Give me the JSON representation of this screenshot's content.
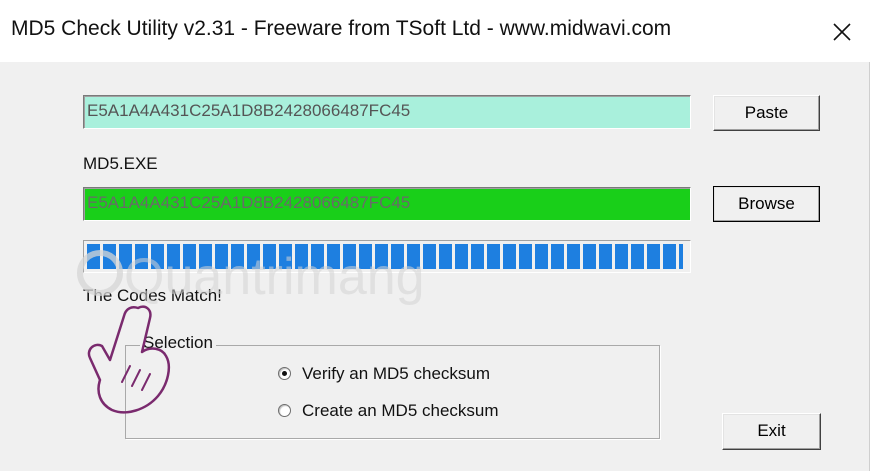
{
  "window": {
    "title": "MD5 Check Utility v2.31 - Freeware from TSoft Ltd - www.midwavi.com",
    "close_glyph": "✕"
  },
  "hash_input": {
    "value": "E5A1A4A431C25A1D8B2428066487FC45",
    "color": "#a9f0dc"
  },
  "paste_button": {
    "label": "Paste"
  },
  "file": {
    "name": "MD5.EXE",
    "hash": "E5A1A4A431C25A1D8B2428066487FC45",
    "color": "#19cf19"
  },
  "browse_button": {
    "label": "Browse"
  },
  "progress": {
    "value": 1.0,
    "color": "#1e7fe0"
  },
  "status": {
    "text": "The Codes Match!"
  },
  "selection": {
    "legend": "Selection",
    "options": [
      {
        "label": "Verify an MD5 checksum",
        "selected": true
      },
      {
        "label": "Create an MD5 checksum",
        "selected": false
      }
    ]
  },
  "exit_button": {
    "label": "Exit"
  },
  "watermark": {
    "text": "Quantrimang",
    "icon": "hand-pointer-icon"
  }
}
